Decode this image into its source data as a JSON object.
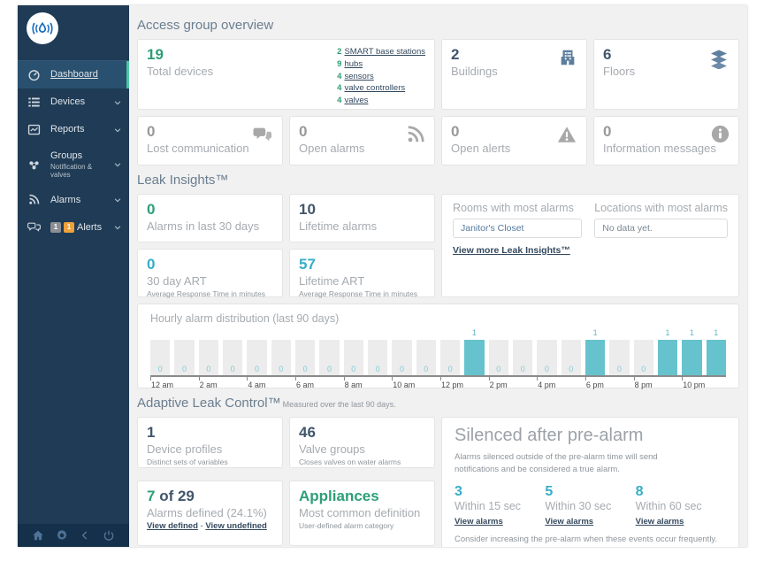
{
  "sidebar": {
    "items": [
      {
        "label": "Dashboard"
      },
      {
        "label": "Devices"
      },
      {
        "label": "Reports"
      },
      {
        "label": "Groups",
        "sublabel": "Notification & valves"
      },
      {
        "label": "Alarms"
      },
      {
        "label": "Alerts",
        "badge_gray": "1",
        "badge_orange": "1"
      }
    ]
  },
  "overview": {
    "title": "Access group overview",
    "total_devices": {
      "value": "19",
      "label": "Total devices",
      "links": [
        {
          "count": "2",
          "label": "SMART base stations"
        },
        {
          "count": "9",
          "label": "hubs"
        },
        {
          "count": "4",
          "label": "sensors"
        },
        {
          "count": "4",
          "label": "valve controllers"
        },
        {
          "count": "4",
          "label": "valves"
        }
      ]
    },
    "buildings": {
      "value": "2",
      "label": "Buildings"
    },
    "floors": {
      "value": "6",
      "label": "Floors"
    },
    "lost_communication": {
      "value": "0",
      "label": "Lost communication"
    },
    "open_alarms": {
      "value": "0",
      "label": "Open alarms"
    },
    "open_alerts": {
      "value": "0",
      "label": "Open alerts"
    },
    "information_messages": {
      "value": "0",
      "label": "Information messages"
    }
  },
  "leak_insights": {
    "title": "Leak Insights™",
    "alarms_30": {
      "value": "0",
      "label": "Alarms in last 30 days"
    },
    "lifetime_alarms": {
      "value": "10",
      "label": "Lifetime alarms"
    },
    "art_30": {
      "value": "0",
      "label": "30 day ART",
      "sublabel": "Average Response Time in minutes"
    },
    "lifetime_art": {
      "value": "57",
      "label": "Lifetime ART",
      "sublabel": "Average Response Time in minutes"
    },
    "rooms": {
      "label": "Rooms with most alarms",
      "value": "Janitor's Closet"
    },
    "locations": {
      "label": "Locations with most alarms",
      "value": "No data yet."
    },
    "view_more": "View more Leak Insights™"
  },
  "chart_data": {
    "type": "bar",
    "title": "Hourly alarm distribution (last 90 days)",
    "categories": [
      "12 am",
      "1 am",
      "2 am",
      "3 am",
      "4 am",
      "5 am",
      "6 am",
      "7 am",
      "8 am",
      "9 am",
      "10 am",
      "11 am",
      "12 pm",
      "1 pm",
      "2 pm",
      "3 pm",
      "4 pm",
      "5 pm",
      "6 pm",
      "7 pm",
      "8 pm",
      "9 pm",
      "10 pm",
      "11 pm"
    ],
    "values": [
      0,
      0,
      0,
      0,
      0,
      0,
      0,
      0,
      0,
      0,
      0,
      0,
      0,
      1,
      0,
      0,
      0,
      0,
      1,
      0,
      0,
      1,
      1,
      1
    ],
    "tick_labels": [
      "12 am",
      "2 am",
      "4 am",
      "6 am",
      "8 am",
      "10 am",
      "12 pm",
      "2 pm",
      "4 pm",
      "6 pm",
      "8 pm",
      "10 pm"
    ],
    "ylim": [
      0,
      1
    ],
    "bar_color": "#66c3cd",
    "placeholder_color": "#ececec",
    "grid": false,
    "legend": false
  },
  "adaptive": {
    "title": "Adaptive Leak Control™",
    "subtitle": "Measured over the last 90 days.",
    "device_profiles": {
      "value": "1",
      "label": "Device profiles",
      "sublabel": "Distinct sets of variables"
    },
    "valve_groups": {
      "value": "46",
      "label": "Valve groups",
      "sublabel": "Closes valves on water alarms"
    },
    "alarms_defined": {
      "value_green": "7",
      "value_rest": " of 29",
      "label": "Alarms defined (24.1%)",
      "link_defined": "View defined",
      "separator": " - ",
      "link_undefined": "View undefined"
    },
    "appliances": {
      "value": "Appliances",
      "label": "Most common definition",
      "sublabel": "User-defined alarm category"
    },
    "silenced": {
      "title": "Silenced after pre-alarm",
      "description": "Alarms silenced outside of the pre-alarm time will send notifications and be considered a true alarm.",
      "columns": [
        {
          "value": "3",
          "label": "Within 15 sec",
          "link": "View alarms"
        },
        {
          "value": "5",
          "label": "Within 30 sec",
          "link": "View alarms"
        },
        {
          "value": "8",
          "label": "Within 60 sec",
          "link": "View alarms"
        }
      ],
      "footer": "Consider increasing the pre-alarm when these events occur frequently."
    }
  },
  "colors": {
    "accent_teal": "#4ec4a6",
    "brand_blue": "#1b6ec2",
    "green": "#2e9e78",
    "teal_number": "#35aec6",
    "navy_number": "#41566b",
    "sidebar_bg": "#1f3b55",
    "badge_orange": "#f0a13b"
  }
}
